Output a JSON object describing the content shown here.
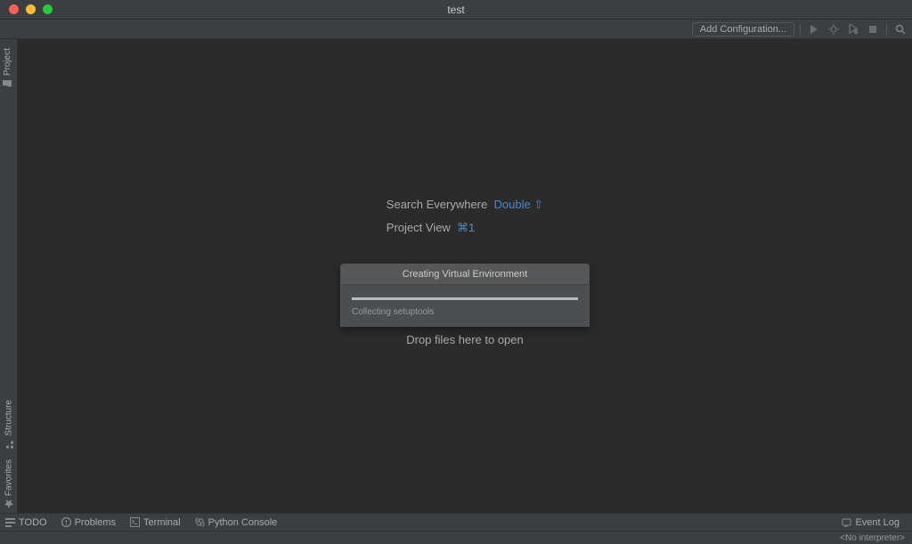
{
  "window": {
    "title": "test"
  },
  "toolbar": {
    "add_config": "Add Configuration..."
  },
  "left_rail": {
    "project": "Project",
    "structure": "Structure",
    "favorites": "Favorites"
  },
  "hints": {
    "search_label": "Search Everywhere",
    "search_shortcut": "Double ⇧",
    "project_label": "Project View",
    "project_shortcut": "⌘1",
    "drop": "Drop files here to open"
  },
  "progress": {
    "title": "Creating Virtual Environment",
    "status": "Collecting setuptools"
  },
  "bottom": {
    "todo": "TODO",
    "problems": "Problems",
    "terminal": "Terminal",
    "python_console": "Python Console",
    "event_log": "Event Log"
  },
  "status": {
    "interpreter": "<No interpreter>"
  }
}
